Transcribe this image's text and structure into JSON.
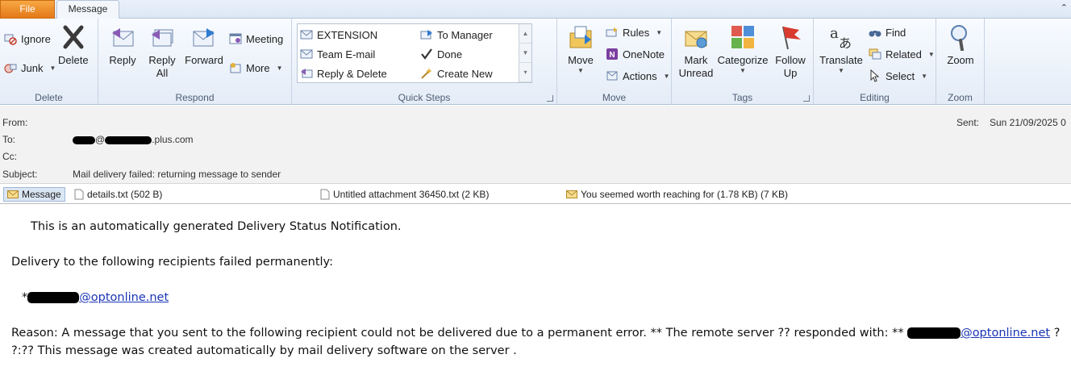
{
  "tabs": {
    "file": "File",
    "message": "Message"
  },
  "ribbon": {
    "delete_group": {
      "label": "Delete",
      "ignore": "Ignore",
      "junk": "Junk",
      "delete": "Delete"
    },
    "respond_group": {
      "label": "Respond",
      "reply": "Reply",
      "reply_all_1": "Reply",
      "reply_all_2": "All",
      "forward": "Forward",
      "meeting": "Meeting",
      "more": "More"
    },
    "quicksteps_group": {
      "label": "Quick Steps",
      "items": [
        "EXTENSION",
        "To Manager",
        "Team E-mail",
        "Done",
        "Reply & Delete",
        "Create New"
      ]
    },
    "move_group": {
      "label": "Move",
      "move": "Move",
      "rules": "Rules",
      "onenote": "OneNote",
      "actions": "Actions"
    },
    "tags_group": {
      "label": "Tags",
      "mark_unread_1": "Mark",
      "mark_unread_2": "Unread",
      "categorize": "Categorize",
      "follow_up_1": "Follow",
      "follow_up_2": "Up"
    },
    "editing_group": {
      "label": "Editing",
      "translate": "Translate",
      "find": "Find",
      "related": "Related",
      "select": "Select"
    },
    "zoom_group": {
      "label": "Zoom",
      "zoom": "Zoom"
    }
  },
  "header": {
    "from_label": "From:",
    "to_label": "To:",
    "to_value_suffix": "plus.com",
    "cc_label": "Cc:",
    "subject_label": "Subject:",
    "subject": "Mail delivery failed: returning message to sender",
    "sent_label": "Sent:",
    "sent_value": "Sun 21/09/2025 0"
  },
  "attachments": {
    "message_tab": "Message",
    "items": [
      "details.txt (502 B)",
      "Untitled attachment 36450.txt (2 KB)",
      "You seemed worth reaching for (1.78 KB) (7 KB)"
    ]
  },
  "body": {
    "line1": "This is an automatically generated Delivery Status Notification.",
    "line2": "Delivery to the following recipients failed permanently:",
    "recipient_prefix": "*",
    "recipient_domain": "@optonline.net",
    "reason": "Reason: A message that you sent to the following recipient could not be delivered due to a permanent error. ** The remote server ?? responded with: **",
    "reason_link_domain": "@optonline.net",
    "reason_tail": "?",
    "line_last": "?:?? This message was created automatically by mail delivery software on the server ."
  }
}
